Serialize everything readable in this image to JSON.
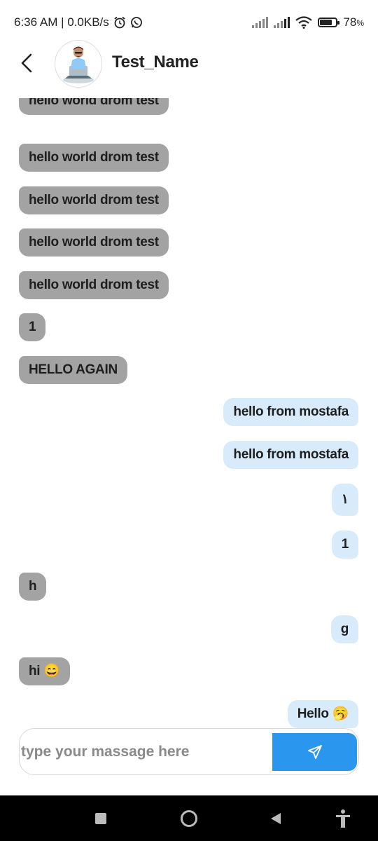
{
  "status": {
    "time_net": "6:36 AM | 0.0KB/s",
    "battery": "78",
    "battery_unit": "%",
    "battery_level": 0.78
  },
  "header": {
    "title": "Test_Name"
  },
  "messages": [
    {
      "text": "hello world drom test",
      "dir": "in"
    },
    {
      "text": "hello world drom test",
      "dir": "in"
    },
    {
      "text": "hello world drom test",
      "dir": "in"
    },
    {
      "text": "hello world drom test",
      "dir": "in"
    },
    {
      "text": "hello world drom test",
      "dir": "in"
    },
    {
      "text": "1",
      "dir": "in"
    },
    {
      "text": "HELLO AGAIN",
      "dir": "in"
    },
    {
      "text": "hello from mostafa",
      "dir": "out"
    },
    {
      "text": "hello from mostafa",
      "dir": "out"
    },
    {
      "text": "١",
      "dir": "out"
    },
    {
      "text": "1",
      "dir": "out"
    },
    {
      "text": "h",
      "dir": "in"
    },
    {
      "text": "g",
      "dir": "out"
    },
    {
      "text": "hi 😄",
      "dir": "in"
    },
    {
      "text": "Hello 🥱",
      "dir": "out"
    }
  ],
  "composer": {
    "placeholder": "type your massage here",
    "value": ""
  },
  "colors": {
    "incoming_bubble": "#a3a3a3",
    "outgoing_bubble": "#d7ebfb",
    "send_button": "#2a96ee"
  },
  "icons": {
    "back": "chevron-left-icon",
    "send": "paper-plane-icon",
    "alarm": "alarm-clock-icon",
    "whatsapp": "whatsapp-icon",
    "wifi": "wifi-icon",
    "nav_recent": "square-icon",
    "nav_home": "circle-icon",
    "nav_back": "triangle-back-icon",
    "nav_accessibility": "accessibility-icon"
  }
}
